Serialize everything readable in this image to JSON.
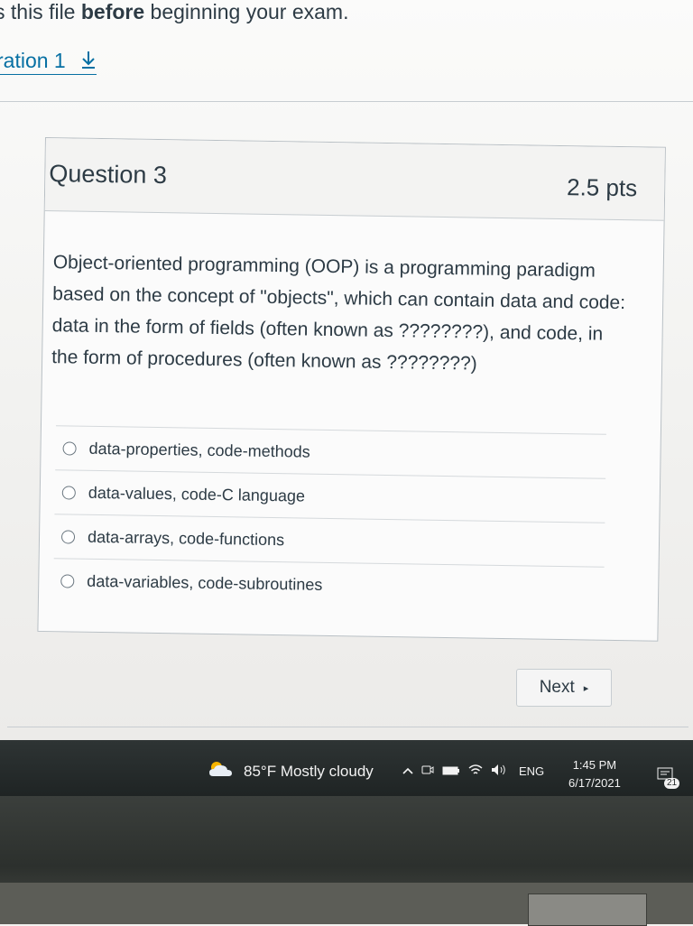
{
  "header": {
    "intro_before": "s this file ",
    "intro_bold": "before",
    "intro_after": " beginning your exam.",
    "file_link": "ration 1"
  },
  "question": {
    "title": "Question 3",
    "points": "2.5 pts",
    "text": "Object-oriented programming (OOP) is a programming paradigm based on the concept of \"objects\", which can contain data and code: data in the form of fields (often known as ????????), and code, in the form of procedures (often known as ????????)",
    "answers": [
      {
        "label": "data-properties, code-methods",
        "selected": false
      },
      {
        "label": "data-values, code-C language",
        "selected": false
      },
      {
        "label": "data-arrays, code-functions",
        "selected": false
      },
      {
        "label": "data-variables, code-subroutines",
        "selected": false
      }
    ]
  },
  "navigation": {
    "next_label": "Next"
  },
  "taskbar": {
    "weather": "85°F  Mostly cloudy",
    "language": "ENG",
    "time": "1:45 PM",
    "date": "6/17/2021",
    "notification_count": "21",
    "icons": [
      "weather-cloud-icon",
      "chevron-up-icon",
      "meet-now-icon",
      "battery-icon",
      "wifi-icon",
      "volume-icon",
      "notification-icon"
    ]
  },
  "colors": {
    "link": "#0770a3",
    "text": "#2d3b45",
    "taskbar": "#1f2424"
  }
}
